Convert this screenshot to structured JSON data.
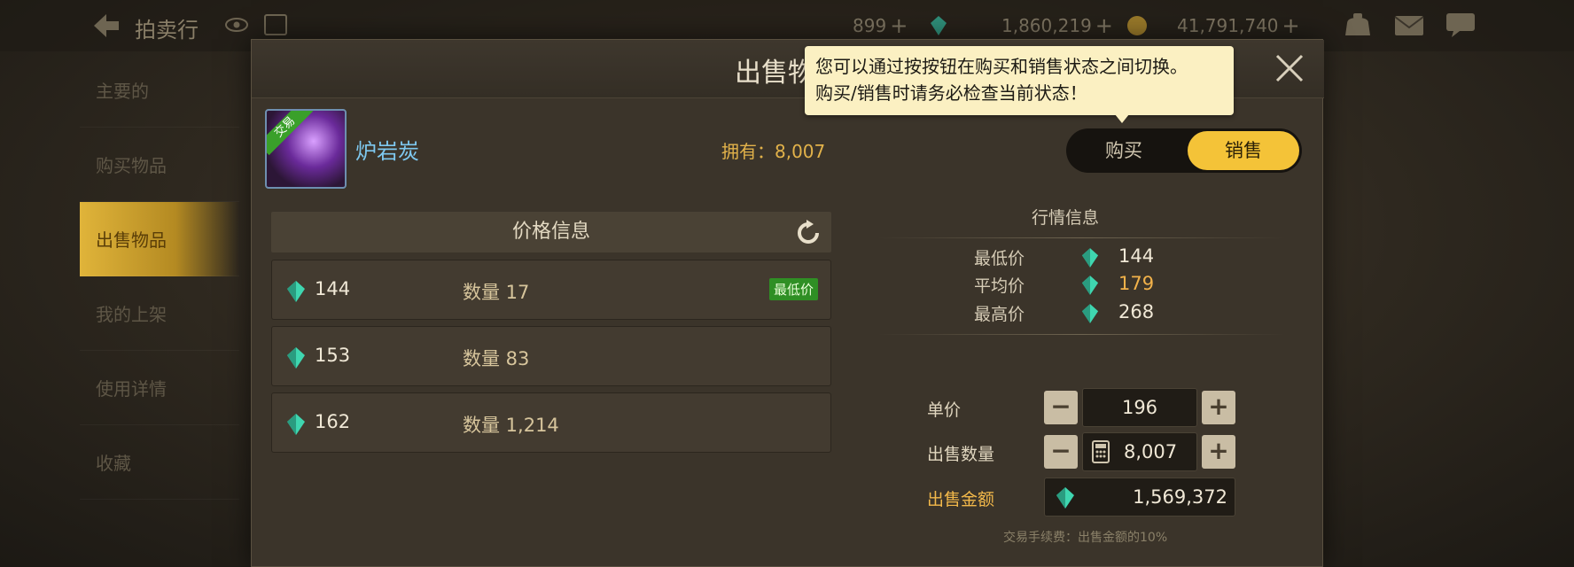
{
  "topbar": {
    "title": "拍卖行",
    "currencies": [
      {
        "icon": "moon-token-icon",
        "value": "899",
        "plus": "+"
      },
      {
        "icon": "gem-icon",
        "value": "1,860,219",
        "plus": "+"
      },
      {
        "icon": "gold-coin-icon",
        "value": "41,791,740",
        "plus": "+"
      }
    ]
  },
  "sidebar": {
    "items": [
      {
        "label": "主要的",
        "active": false
      },
      {
        "label": "购买物品",
        "active": false
      },
      {
        "label": "出售物品",
        "active": true
      },
      {
        "label": "我的上架",
        "active": false
      },
      {
        "label": "使用详情",
        "active": false
      },
      {
        "label": "收藏",
        "active": false
      }
    ]
  },
  "dialog": {
    "title": "出售物",
    "item": {
      "name": "炉岩炭",
      "badge": "交易",
      "owned_label": "拥有：8,007"
    },
    "toggle": {
      "buy": "购买",
      "sell": "销售",
      "selected": "sell"
    },
    "tooltip": {
      "line1": "您可以通过按按钮在购买和销售状态之间切换。",
      "line2": "购买/销售时请务必检查当前状态！"
    },
    "price_info": {
      "title": "价格信息",
      "rows": [
        {
          "price": "144",
          "qty": "数量 17",
          "badge": "最低价"
        },
        {
          "price": "153",
          "qty": "数量 83",
          "badge": ""
        },
        {
          "price": "162",
          "qty": "数量 1,214",
          "badge": ""
        }
      ]
    },
    "market": {
      "title": "行情信息",
      "min_label": "最低价",
      "min_value": "144",
      "avg_label": "平均价",
      "avg_value": "179",
      "max_label": "最高价",
      "max_value": "268"
    },
    "form": {
      "unit_price_label": "单价",
      "unit_price": "196",
      "qty_label": "出售数量",
      "qty": "8,007",
      "total_label": "出售金额",
      "total": "1,569,372",
      "minus": "−",
      "plus": "+",
      "fee_note": "交易手续费：出售金额的10%"
    }
  },
  "colors": {
    "accent": "#f4c338",
    "gem": "#3fd6b0",
    "sell_total": "#f2b84a"
  }
}
